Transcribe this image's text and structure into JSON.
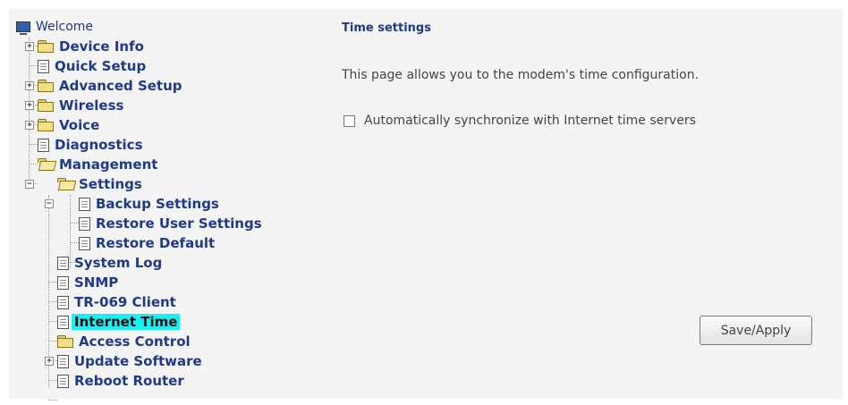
{
  "tree": {
    "welcome": "Welcome",
    "device_info": "Device Info",
    "quick_setup": "Quick Setup",
    "advanced_setup": "Advanced Setup",
    "wireless": "Wireless",
    "voice": "Voice",
    "diagnostics": "Diagnostics",
    "management": "Management",
    "settings": "Settings",
    "backup_settings": "Backup Settings",
    "restore_user_settings": "Restore User Settings",
    "restore_default": "Restore Default",
    "system_log": "System Log",
    "snmp": "SNMP",
    "tr069_client": "TR-069 Client",
    "internet_time": "Internet Time",
    "access_control": "Access Control",
    "update_software": "Update Software",
    "reboot_router": "Reboot Router",
    "expand_symbol": "+",
    "collapse_symbol": "−",
    "active_highlight_color": "#19f0f5"
  },
  "content": {
    "title": "Time settings",
    "description": "This page allows you to the modem's time configuration.",
    "auto_sync_label": "Automatically synchronize with Internet time servers",
    "auto_sync_checked": false,
    "save_button": "Save/Apply"
  }
}
